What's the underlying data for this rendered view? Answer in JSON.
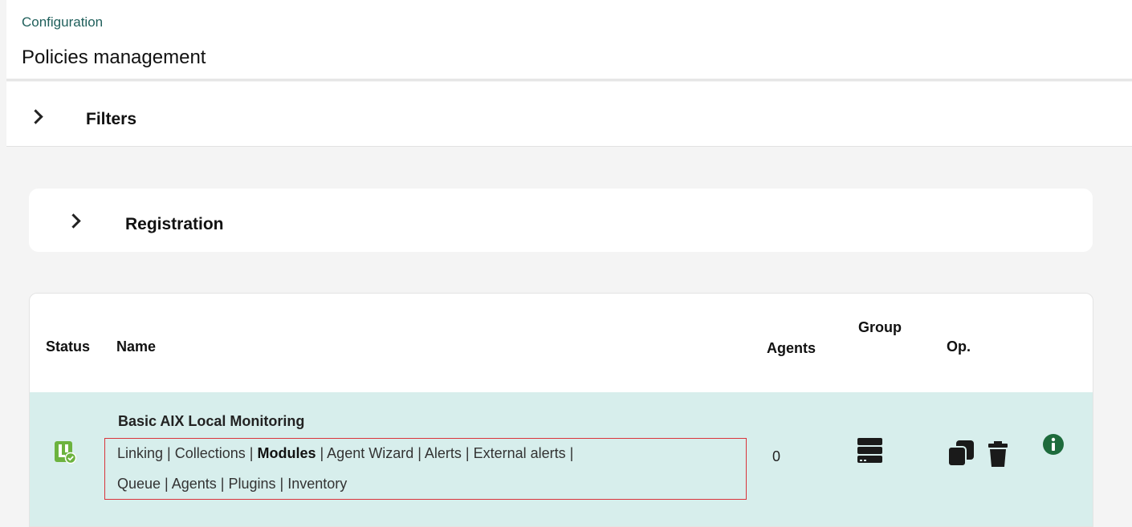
{
  "header": {
    "breadcrumb": "Configuration",
    "title": "Policies management"
  },
  "filters": {
    "label": "Filters",
    "icon": "chevron-right-icon"
  },
  "registration": {
    "label": "Registration",
    "icon": "chevron-right-icon"
  },
  "table": {
    "columns": [
      "Status",
      "Name",
      "Agents",
      "Group",
      "Op."
    ],
    "rows": [
      {
        "name": "Basic AIX Local Monitoring",
        "status_icon": "policy-status-ok-icon",
        "links": [
          "Linking",
          "Collections",
          "Modules",
          "Agent Wizard",
          "Alerts",
          "External alerts",
          "Queue",
          "Agents",
          "Plugins",
          "Inventory"
        ],
        "active_link": "Modules",
        "agents": "0",
        "group_icon": "server-icon",
        "operations": [
          "copy-icon",
          "trash-icon",
          "info-icon"
        ]
      }
    ]
  },
  "colors": {
    "row_highlight": "#d7eeec",
    "status_green": "#6cb33f",
    "info_green": "#1d6b3c",
    "selection_box": "#d9343b"
  }
}
